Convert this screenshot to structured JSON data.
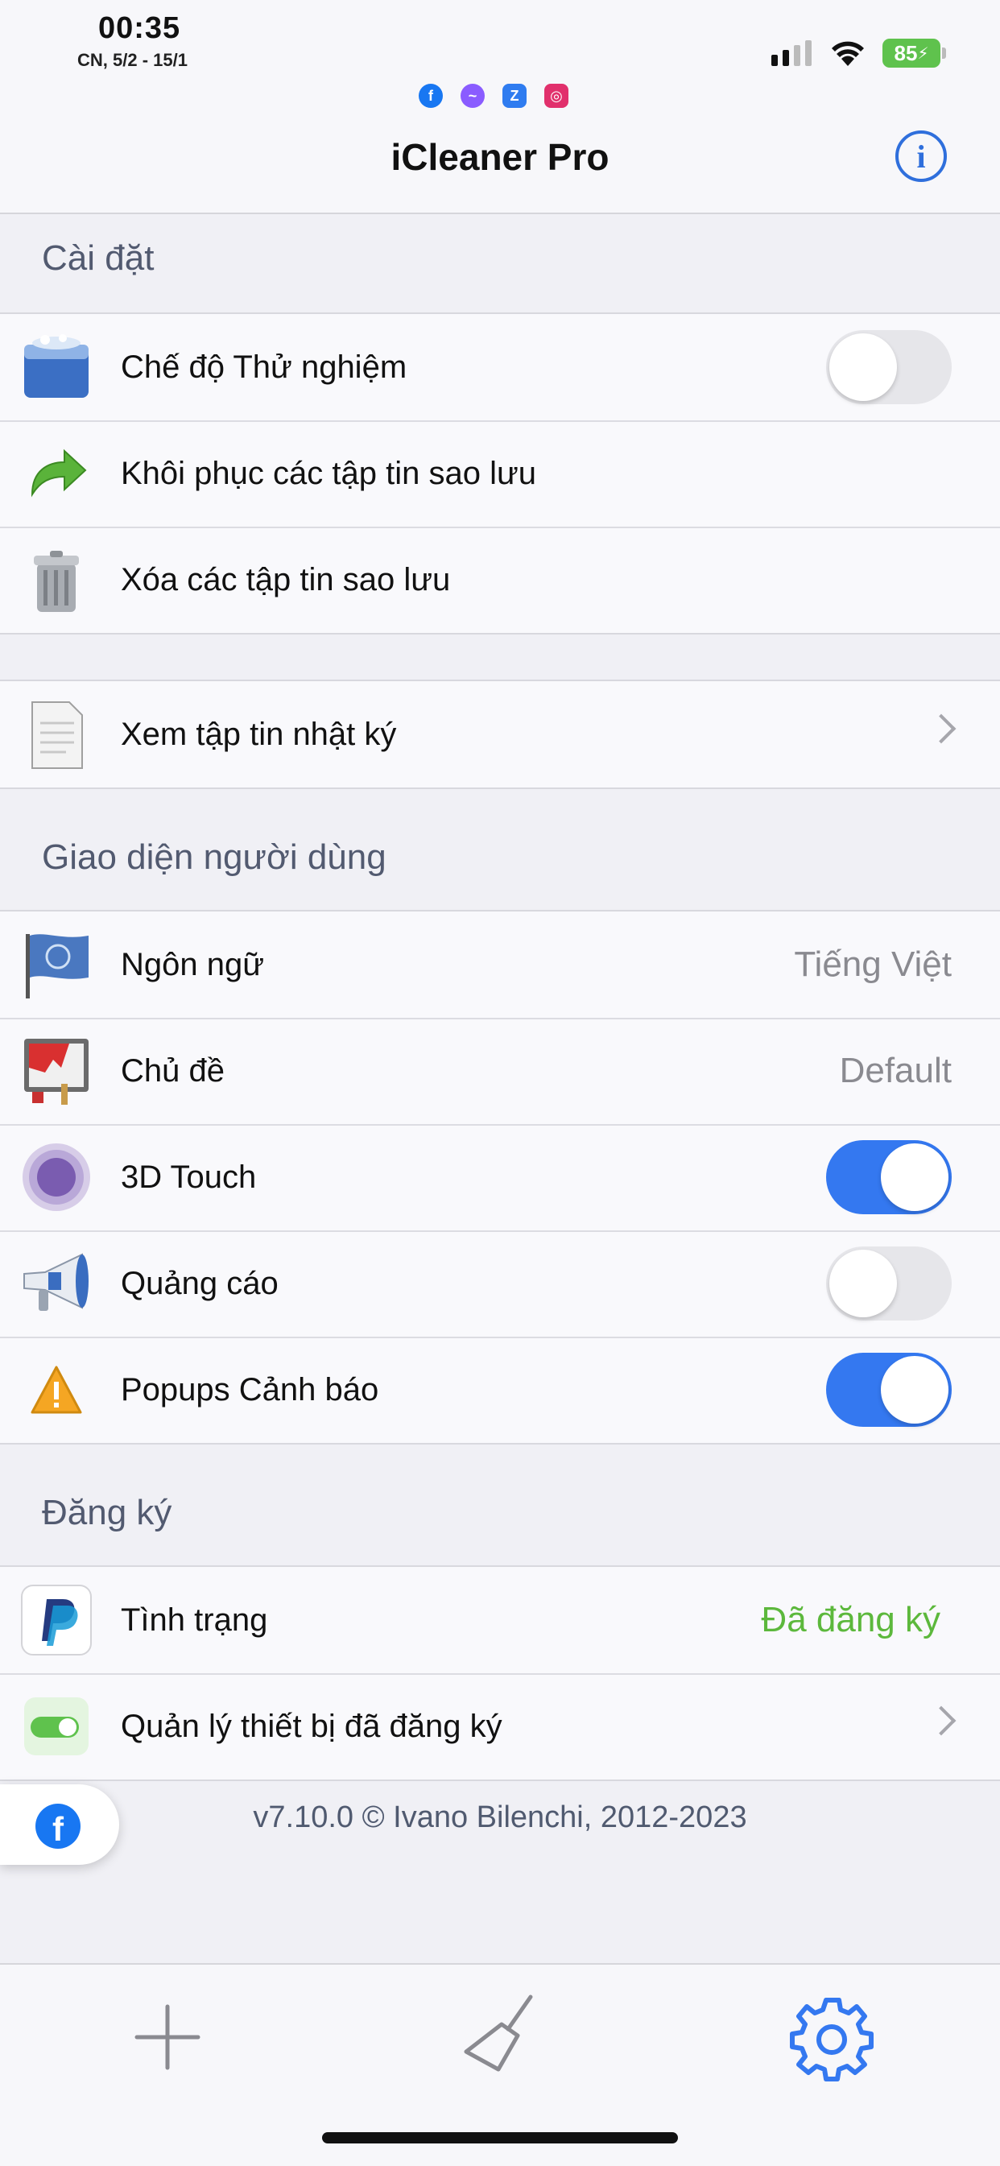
{
  "status_bar": {
    "time": "00:35",
    "date": "CN, 5/2 - 15/1",
    "battery": "85"
  },
  "nav": {
    "title": "iCleaner Pro",
    "info_icon": "info-icon"
  },
  "sections": {
    "settings": {
      "header": "Cài đặt",
      "items": [
        {
          "label": "Chế độ Thử nghiệm",
          "icon": "washer-icon",
          "toggle": false
        },
        {
          "label": "Khôi phục các tập tin sao lưu",
          "icon": "restore-arrow-icon"
        },
        {
          "label": "Xóa các tập tin sao lưu",
          "icon": "trash-can-icon"
        }
      ]
    },
    "logs": {
      "items": [
        {
          "label": "Xem tập tin nhật ký",
          "icon": "document-icon"
        }
      ]
    },
    "ui": {
      "header": "Giao diện người dùng",
      "items": [
        {
          "label": "Ngôn ngữ",
          "value": "Tiếng Việt",
          "icon": "flag-icon"
        },
        {
          "label": "Chủ đề",
          "value": "Default",
          "icon": "paint-icon"
        },
        {
          "label": "3D Touch",
          "icon": "touch-icon",
          "toggle": true
        },
        {
          "label": "Quảng cáo",
          "icon": "megaphone-icon",
          "toggle": false
        },
        {
          "label": "Popups Cảnh báo",
          "icon": "warning-icon",
          "toggle": true
        }
      ]
    },
    "registration": {
      "header": "Đăng ký",
      "items": [
        {
          "label": "Tình trạng",
          "value": "Đã đăng ký",
          "icon": "paypal-icon"
        },
        {
          "label": "Quản lý thiết bị đã đăng ký",
          "icon": "switch-icon"
        }
      ]
    }
  },
  "footer": {
    "version": "v7.10.0 © Ivano Bilenchi, 2012-2023"
  },
  "colors": {
    "accent": "#3478f0",
    "registered": "#5cb83c",
    "toggle_off": "#e6e6ea"
  }
}
